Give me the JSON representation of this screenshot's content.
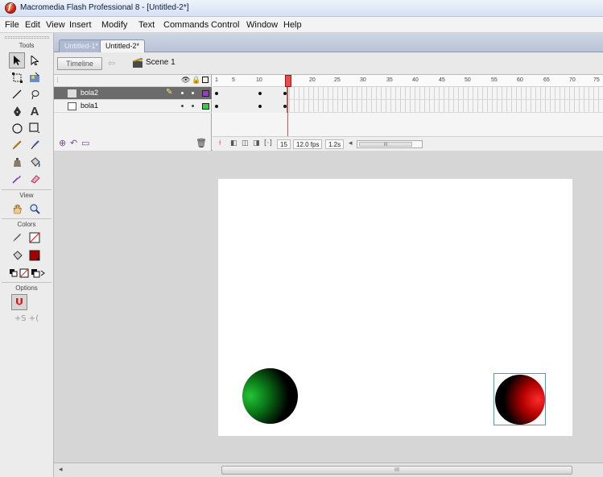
{
  "window": {
    "title": "Macromedia Flash Professional 8 - [Untitled-2*]"
  },
  "menu": [
    "File",
    "Edit",
    "View",
    "Insert",
    "Modify",
    "Text",
    "Commands",
    "Control",
    "Window",
    "Help"
  ],
  "tools": {
    "header": "Tools",
    "view_header": "View",
    "colors_header": "Colors",
    "options_header": "Options"
  },
  "document_tabs": [
    "Untitled-1*",
    "Untitled-2*"
  ],
  "edit_bar": {
    "timeline_label": "Timeline",
    "scene_label": "Scene 1"
  },
  "layers": [
    {
      "name": "bola2",
      "selected": true,
      "color": "#9b3cc8"
    },
    {
      "name": "bola1",
      "selected": false,
      "color": "#3cc84a"
    }
  ],
  "ruler": {
    "labels": [
      "1",
      "5",
      "10",
      "15",
      "20",
      "25",
      "30",
      "35",
      "40",
      "45",
      "50",
      "55",
      "60",
      "65",
      "70",
      "75"
    ]
  },
  "timeline_status": {
    "current_frame": "15",
    "frame_rate": "12.0 fps",
    "elapsed": "1.2s",
    "scroll_glyph": "III"
  },
  "stage": {
    "background": "#ffffff",
    "green_ball_color": "#22c034",
    "red_ball_color": "#ff2020",
    "selection_color": "#3aa0e6"
  },
  "scrollbar": {
    "grip": "III"
  }
}
